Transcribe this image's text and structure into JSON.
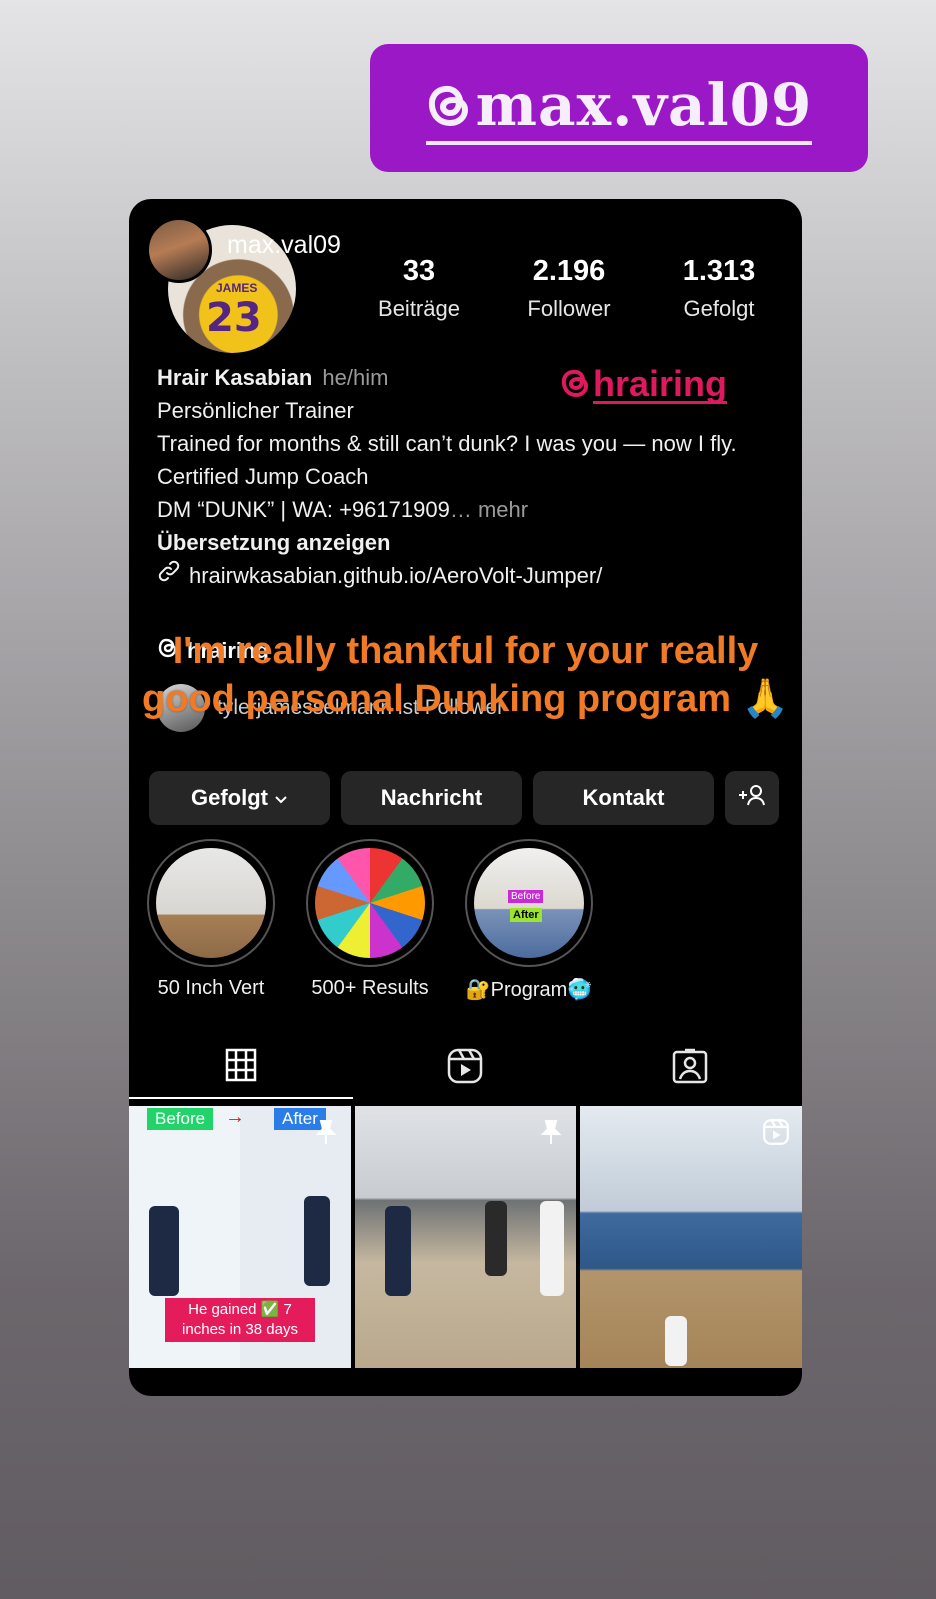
{
  "sticker": {
    "mention": "max.val09"
  },
  "profile": {
    "username": "max.val09",
    "stats": [
      {
        "value": "33",
        "label": "Beiträge"
      },
      {
        "value": "2.196",
        "label": "Follower"
      },
      {
        "value": "1.313",
        "label": "Gefolgt"
      }
    ],
    "jersey_name": "JAMES",
    "jersey_number": "23",
    "name": "Hrair Kasabian",
    "pronouns": "he/him",
    "category": "Persönlicher Trainer",
    "bio_line1": "Trained for months & still can’t dunk? I was you — now I fly.",
    "bio_line2": "Certified Jump Coach",
    "bio_line3": "DM “DUNK” | WA: +96171909",
    "more_label": "… mehr",
    "translate_label": "Übersetzung anzeigen",
    "link": "hrairwkasabian.github.io/AeroVolt-Jumper/",
    "threads_handle": "hrairing",
    "follower_text": "tylerjamesselmann ist Follower"
  },
  "threads_sticker": {
    "handle": "hrairing"
  },
  "overlay": {
    "text": "I'm really thankful for your really good personal Dunking program 🙏"
  },
  "buttons": {
    "follow": "Gefolgt",
    "message": "Nachricht",
    "contact": "Kontakt"
  },
  "highlights": [
    {
      "label": "50 Inch Vert"
    },
    {
      "label": "500+ Results"
    },
    {
      "label": "🔐Program🥶"
    }
  ],
  "posts": {
    "post1": {
      "before": "Before",
      "after": "After",
      "caption": "He gained ✅ 7 inches in 38 days"
    },
    "highlight3": {
      "before": "Before",
      "after": "After"
    }
  },
  "colors": {
    "mention_bg": "#9b18c6",
    "threads_tag": "#e0185f",
    "overlay_text": "#f07a26"
  }
}
